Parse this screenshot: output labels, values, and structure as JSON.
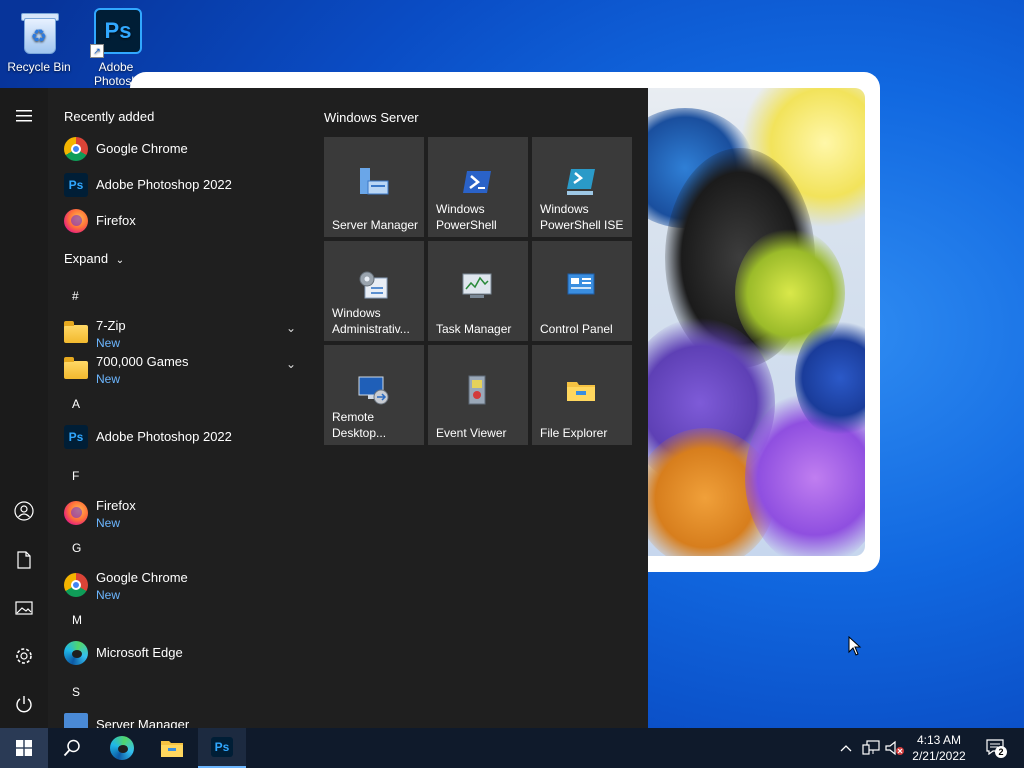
{
  "desktop": {
    "icons": [
      {
        "label": "Recycle Bin"
      },
      {
        "label": "Adobe Photosh"
      }
    ],
    "ps_glyph": "Ps"
  },
  "start_menu": {
    "recently_added_title": "Recently added",
    "recent_apps": [
      {
        "name": "Google Chrome",
        "icon": "chrome-icon"
      },
      {
        "name": "Adobe Photoshop 2022",
        "icon": "photoshop-icon"
      },
      {
        "name": "Firefox",
        "icon": "firefox-icon"
      }
    ],
    "expand_label": "Expand",
    "groups": [
      {
        "letter": "#",
        "apps": [
          {
            "name": "7-Zip",
            "badge": "New",
            "icon": "folder-icon",
            "expandable": true
          },
          {
            "name": "700,000 Games",
            "badge": "New",
            "icon": "folder-icon",
            "expandable": true
          }
        ]
      },
      {
        "letter": "A",
        "apps": [
          {
            "name": "Adobe Photoshop 2022",
            "icon": "photoshop-icon"
          }
        ]
      },
      {
        "letter": "F",
        "apps": [
          {
            "name": "Firefox",
            "badge": "New",
            "icon": "firefox-icon"
          }
        ]
      },
      {
        "letter": "G",
        "apps": [
          {
            "name": "Google Chrome",
            "badge": "New",
            "icon": "chrome-icon"
          }
        ]
      },
      {
        "letter": "M",
        "apps": [
          {
            "name": "Microsoft Edge",
            "icon": "edge-icon"
          }
        ]
      },
      {
        "letter": "S",
        "apps": [
          {
            "name": "Server Manager",
            "icon": "server-manager-icon"
          }
        ]
      }
    ],
    "tiles_group_title": "Windows Server",
    "tiles": [
      {
        "label": "Server Manager",
        "icon": "server-manager-icon"
      },
      {
        "label": "Windows PowerShell",
        "icon": "powershell-icon"
      },
      {
        "label": "Windows PowerShell ISE",
        "icon": "powershell-ise-icon"
      },
      {
        "label": "Windows Administrativ...",
        "icon": "admin-tools-icon"
      },
      {
        "label": "Task Manager",
        "icon": "task-manager-icon"
      },
      {
        "label": "Control Panel",
        "icon": "control-panel-icon"
      },
      {
        "label": "Remote Desktop...",
        "icon": "remote-desktop-icon"
      },
      {
        "label": "Event Viewer",
        "icon": "event-viewer-icon"
      },
      {
        "label": "File Explorer",
        "icon": "file-explorer-icon"
      }
    ],
    "rail_icons": [
      "hamburger-icon",
      "user-icon",
      "documents-icon",
      "pictures-icon",
      "settings-icon",
      "power-icon"
    ]
  },
  "taskbar": {
    "apps": [
      "start-icon",
      "search-icon",
      "edge-icon",
      "file-explorer-icon",
      "photoshop-icon"
    ],
    "ps_glyph": "Ps",
    "clock": {
      "time": "4:13 AM",
      "date": "2/21/2022"
    },
    "notification_count": "2"
  },
  "colors": {
    "accent_new": "#6cb6ff",
    "start_bg": "#1f1f1f",
    "tile_bg": "#3a3a3a",
    "taskbar_bg": "#0f1a2b"
  }
}
